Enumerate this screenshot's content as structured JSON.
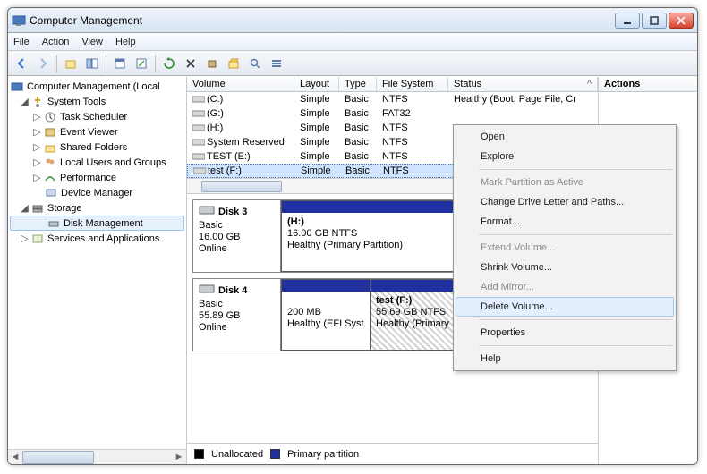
{
  "window": {
    "title": "Computer Management"
  },
  "menu": {
    "file": "File",
    "action": "Action",
    "view": "View",
    "help": "Help"
  },
  "tree": {
    "root": "Computer Management (Local",
    "systools": "System Tools",
    "task": "Task Scheduler",
    "event": "Event Viewer",
    "shared": "Shared Folders",
    "users": "Local Users and Groups",
    "perf": "Performance",
    "devmgr": "Device Manager",
    "storage": "Storage",
    "diskmgmt": "Disk Management",
    "services": "Services and Applications"
  },
  "cols": {
    "volume": "Volume",
    "layout": "Layout",
    "type": "Type",
    "fs": "File System",
    "status": "Status"
  },
  "volumes": [
    {
      "name": "(C:)",
      "layout": "Simple",
      "type": "Basic",
      "fs": "NTFS",
      "status": "Healthy (Boot, Page File, Cr"
    },
    {
      "name": "(G:)",
      "layout": "Simple",
      "type": "Basic",
      "fs": "FAT32",
      "status": ""
    },
    {
      "name": "(H:)",
      "layout": "Simple",
      "type": "Basic",
      "fs": "NTFS",
      "status": ""
    },
    {
      "name": "System Reserved",
      "layout": "Simple",
      "type": "Basic",
      "fs": "NTFS",
      "status": ""
    },
    {
      "name": "TEST (E:)",
      "layout": "Simple",
      "type": "Basic",
      "fs": "NTFS",
      "status": ""
    },
    {
      "name": "test (F:)",
      "layout": "Simple",
      "type": "Basic",
      "fs": "NTFS",
      "status": ""
    }
  ],
  "disks": {
    "d3": {
      "title": "Disk 3",
      "kind": "Basic",
      "size": "16.00 GB",
      "state": "Online",
      "p1": {
        "label": "(H:)",
        "line2": "16.00 GB NTFS",
        "line3": "Healthy (Primary Partition)"
      }
    },
    "d4": {
      "title": "Disk 4",
      "kind": "Basic",
      "size": "55.89 GB",
      "state": "Online",
      "p1": {
        "label": "",
        "line2": "200 MB",
        "line3": "Healthy (EFI Syst"
      },
      "p2": {
        "label": "test  (F:)",
        "line2": "55.69 GB NTFS",
        "line3": "Healthy (Primary Partition)"
      }
    }
  },
  "legend": {
    "unalloc": "Unallocated",
    "primary": "Primary partition"
  },
  "actions": {
    "header": "Actions"
  },
  "ctx": {
    "open": "Open",
    "explore": "Explore",
    "mark": "Mark Partition as Active",
    "change": "Change Drive Letter and Paths...",
    "format": "Format...",
    "extend": "Extend Volume...",
    "shrink": "Shrink Volume...",
    "mirror": "Add Mirror...",
    "delete": "Delete Volume...",
    "props": "Properties",
    "help": "Help"
  }
}
